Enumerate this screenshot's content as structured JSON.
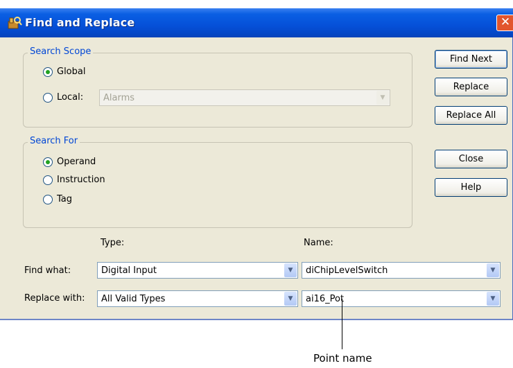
{
  "window": {
    "title": "Find and Replace",
    "close_glyph": "✕"
  },
  "search_scope": {
    "label": "Search Scope",
    "options": [
      {
        "label": "Global",
        "checked": true
      },
      {
        "label": "Local:",
        "checked": false
      }
    ],
    "local_combo": {
      "value": "Alarms",
      "disabled": true
    }
  },
  "search_for": {
    "label": "Search For",
    "options": [
      {
        "label": "Operand",
        "checked": true
      },
      {
        "label": "Instruction",
        "checked": false
      },
      {
        "label": "Tag",
        "checked": false
      }
    ]
  },
  "buttons": {
    "find_next": "Find Next",
    "replace": "Replace",
    "replace_all": "Replace All",
    "close": "Close",
    "help": "Help"
  },
  "fields": {
    "type_header": "Type:",
    "name_header": "Name:",
    "find_what_label": "Find what:",
    "replace_with_label": "Replace with:",
    "find_type": "Digital Input",
    "find_name": "diChipLevelSwitch",
    "replace_type": "All Valid Types",
    "replace_name": "ai16_Pot"
  },
  "callout": {
    "text": "Point name"
  },
  "icons": {
    "title": "find-replace-icon",
    "close": "close-icon",
    "dropdown": "chevron-down-icon"
  },
  "colors": {
    "titlebar": "#0550d8",
    "dialog_bg": "#ece9d8",
    "group_label": "#0046d5",
    "close_button": "#e2552d"
  }
}
